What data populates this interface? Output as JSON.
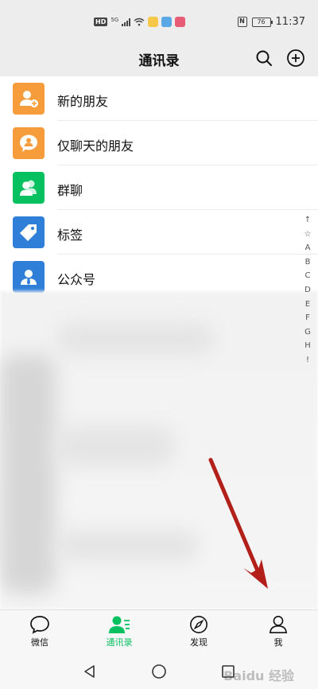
{
  "status_bar": {
    "left_badge": "HD",
    "network": "5G",
    "battery": "76",
    "time": "11:37",
    "nfc": "N"
  },
  "header": {
    "title": "通讯录",
    "search_icon": "search-icon",
    "add_icon": "plus-circle-icon"
  },
  "contacts_menu": [
    {
      "label": "新的朋友",
      "icon": "add-friend-icon",
      "color": "#f79c3a"
    },
    {
      "label": "仅聊天的朋友",
      "icon": "chat-only-friend-icon",
      "color": "#f79c3a"
    },
    {
      "label": "群聊",
      "icon": "group-chat-icon",
      "color": "#07c160"
    },
    {
      "label": "标签",
      "icon": "tag-icon",
      "color": "#2f7fd8"
    },
    {
      "label": "公众号",
      "icon": "official-account-icon",
      "color": "#2f7fd8"
    }
  ],
  "alphabet_index": [
    "↑",
    "☆",
    "A",
    "B",
    "C",
    "D",
    "E",
    "F",
    "G",
    "H",
    "!"
  ],
  "tabs": [
    {
      "label": "微信",
      "icon": "chat-bubble-icon",
      "active": false
    },
    {
      "label": "通讯录",
      "icon": "contacts-icon",
      "active": true
    },
    {
      "label": "发现",
      "icon": "compass-icon",
      "active": false
    },
    {
      "label": "我",
      "icon": "person-icon",
      "active": false
    }
  ],
  "colors": {
    "accent": "#07c160",
    "annotation_arrow": "#b3201a"
  },
  "watermark": "Baidu 经验"
}
